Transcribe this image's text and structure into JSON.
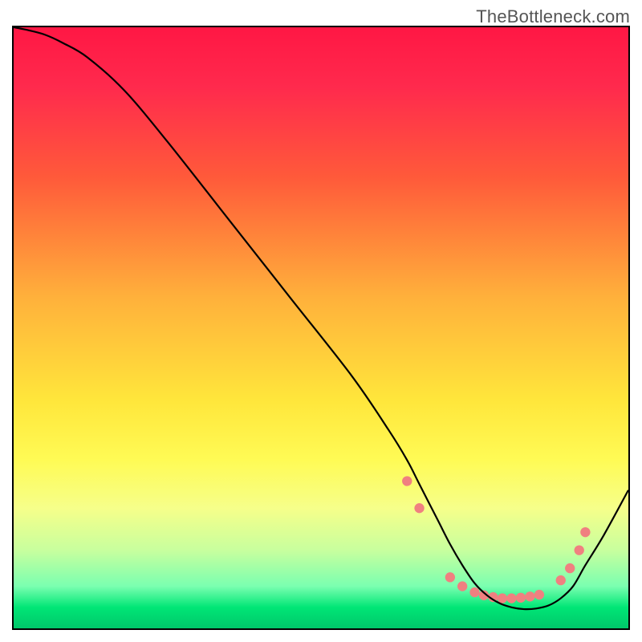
{
  "watermark": "TheBottleneck.com",
  "chart_data": {
    "type": "line",
    "title": "",
    "xlabel": "",
    "ylabel": "",
    "xlim": [
      0,
      100
    ],
    "ylim": [
      0,
      100
    ],
    "grid": false,
    "legend": false,
    "gradient_stops": [
      {
        "offset": 0,
        "color": "#ff1744"
      },
      {
        "offset": 0.1,
        "color": "#ff2a4d"
      },
      {
        "offset": 0.25,
        "color": "#ff5a3a"
      },
      {
        "offset": 0.45,
        "color": "#ffb13b"
      },
      {
        "offset": 0.62,
        "color": "#ffe63b"
      },
      {
        "offset": 0.72,
        "color": "#fffb55"
      },
      {
        "offset": 0.8,
        "color": "#f6ff8a"
      },
      {
        "offset": 0.87,
        "color": "#c8ff9e"
      },
      {
        "offset": 0.93,
        "color": "#7affb0"
      },
      {
        "offset": 0.965,
        "color": "#00e676"
      },
      {
        "offset": 1.0,
        "color": "#00c76a"
      }
    ],
    "series": [
      {
        "name": "bottleneck-curve",
        "color": "#000000",
        "x": [
          0,
          2,
          5,
          8,
          12,
          18,
          25,
          35,
          45,
          55,
          61,
          64,
          66,
          69,
          71,
          73,
          75,
          77,
          79,
          81,
          83,
          85,
          87,
          89,
          91,
          93,
          96,
          100
        ],
        "y": [
          100,
          99.6,
          98.8,
          97.4,
          95,
          89.5,
          81,
          68,
          55,
          42,
          33,
          28,
          24,
          18,
          14,
          10.5,
          7.5,
          5.5,
          4.2,
          3.5,
          3.2,
          3.3,
          3.8,
          5,
          7,
          10.5,
          15.5,
          23
        ]
      }
    ],
    "markers": {
      "comment": "salmon dots along the valley near the curve minimum",
      "color": "#f08080",
      "points": [
        {
          "x": 64,
          "y": 24.5
        },
        {
          "x": 66,
          "y": 20
        },
        {
          "x": 71,
          "y": 8.5
        },
        {
          "x": 73,
          "y": 7
        },
        {
          "x": 75,
          "y": 6
        },
        {
          "x": 76.5,
          "y": 5.5
        },
        {
          "x": 78,
          "y": 5.2
        },
        {
          "x": 79.5,
          "y": 5
        },
        {
          "x": 81,
          "y": 5
        },
        {
          "x": 82.5,
          "y": 5.1
        },
        {
          "x": 84,
          "y": 5.3
        },
        {
          "x": 85.5,
          "y": 5.6
        },
        {
          "x": 89,
          "y": 8
        },
        {
          "x": 90.5,
          "y": 10
        },
        {
          "x": 92,
          "y": 13
        },
        {
          "x": 93,
          "y": 16
        }
      ]
    }
  }
}
